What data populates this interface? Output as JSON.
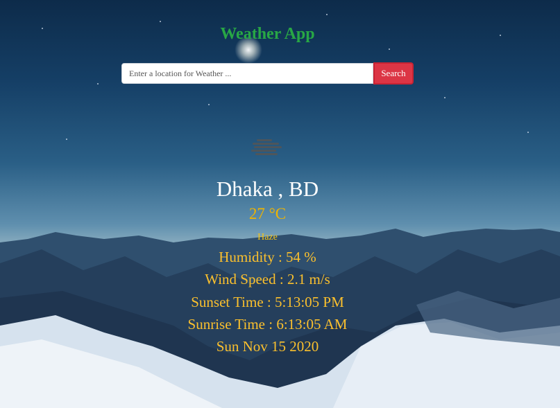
{
  "header": {
    "title": "Weather App"
  },
  "search": {
    "placeholder": "Enter a location for Weather ...",
    "value": "",
    "button_label": "Search"
  },
  "weather": {
    "icon": "haze-icon",
    "location": "Dhaka , BD",
    "temperature": "27 °C",
    "condition": "Haze",
    "humidity": "Humidity : 54 %",
    "wind_speed": "Wind Speed : 2.1 m/s",
    "sunset": "Sunset Time : 5:13:05 PM",
    "sunrise": "Sunrise Time : 6:13:05 AM",
    "date": "Sun Nov 15 2020"
  },
  "colors": {
    "title": "#28a745",
    "button": "#dc3545",
    "location_text": "#ffffff",
    "info_text": "#fbc02d"
  }
}
